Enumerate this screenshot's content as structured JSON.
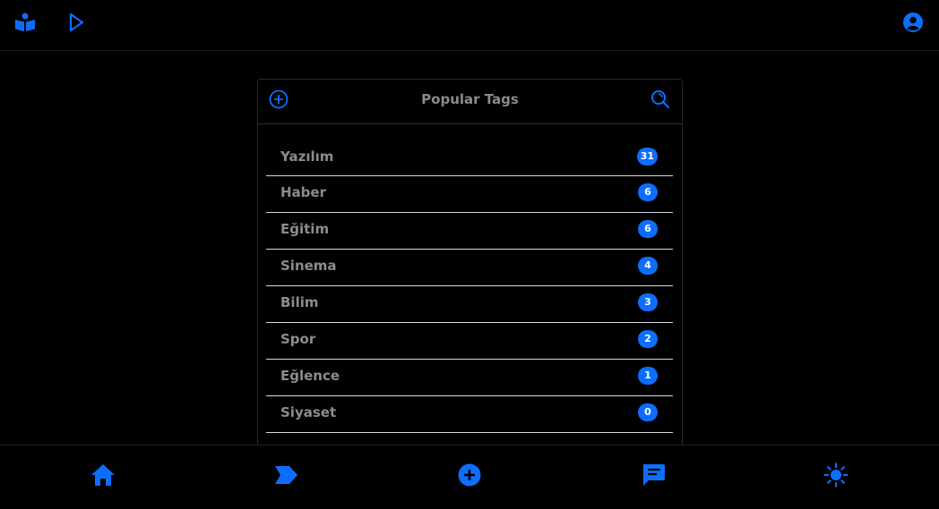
{
  "colors": {
    "accent": "#0d6efd",
    "background": "#000000",
    "text_muted": "#8c8c8c",
    "divider": "#d9d9d9"
  },
  "topbar": {
    "left_icons": [
      "book-reader-icon",
      "play-icon"
    ],
    "right_icons": [
      "user-circle-icon"
    ]
  },
  "card": {
    "title": "Popular Tags",
    "add_icon": "plus-circle-icon",
    "search_icon": "search-icon",
    "tags": [
      {
        "name": "Yazılım",
        "count": "31"
      },
      {
        "name": "Haber",
        "count": "6"
      },
      {
        "name": "Eğitim",
        "count": "6"
      },
      {
        "name": "Sinema",
        "count": "4"
      },
      {
        "name": "Bilim",
        "count": "3"
      },
      {
        "name": "Spor",
        "count": "2"
      },
      {
        "name": "Eğlence",
        "count": "1"
      },
      {
        "name": "Siyaset",
        "count": "0"
      }
    ]
  },
  "bottom_nav": {
    "items": [
      "home-icon",
      "tag-icon",
      "plus-circle-icon",
      "chat-icon",
      "sun-icon"
    ]
  }
}
